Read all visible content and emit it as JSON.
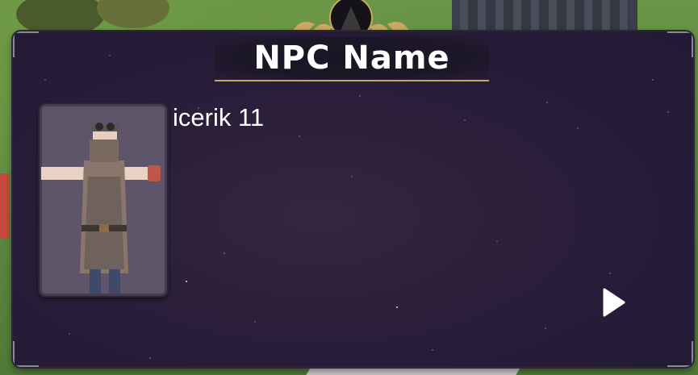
{
  "dialog": {
    "title": "NPC Name",
    "text": "icerik 11",
    "portrait_icon": "npc-blacksmith-portrait",
    "next_icon": "play-triangle-icon"
  },
  "colors": {
    "panel_background": "#2a1e3a",
    "title_underline": "#c8a862",
    "text": "#ffffff",
    "portrait_frame": "#5f556a"
  }
}
